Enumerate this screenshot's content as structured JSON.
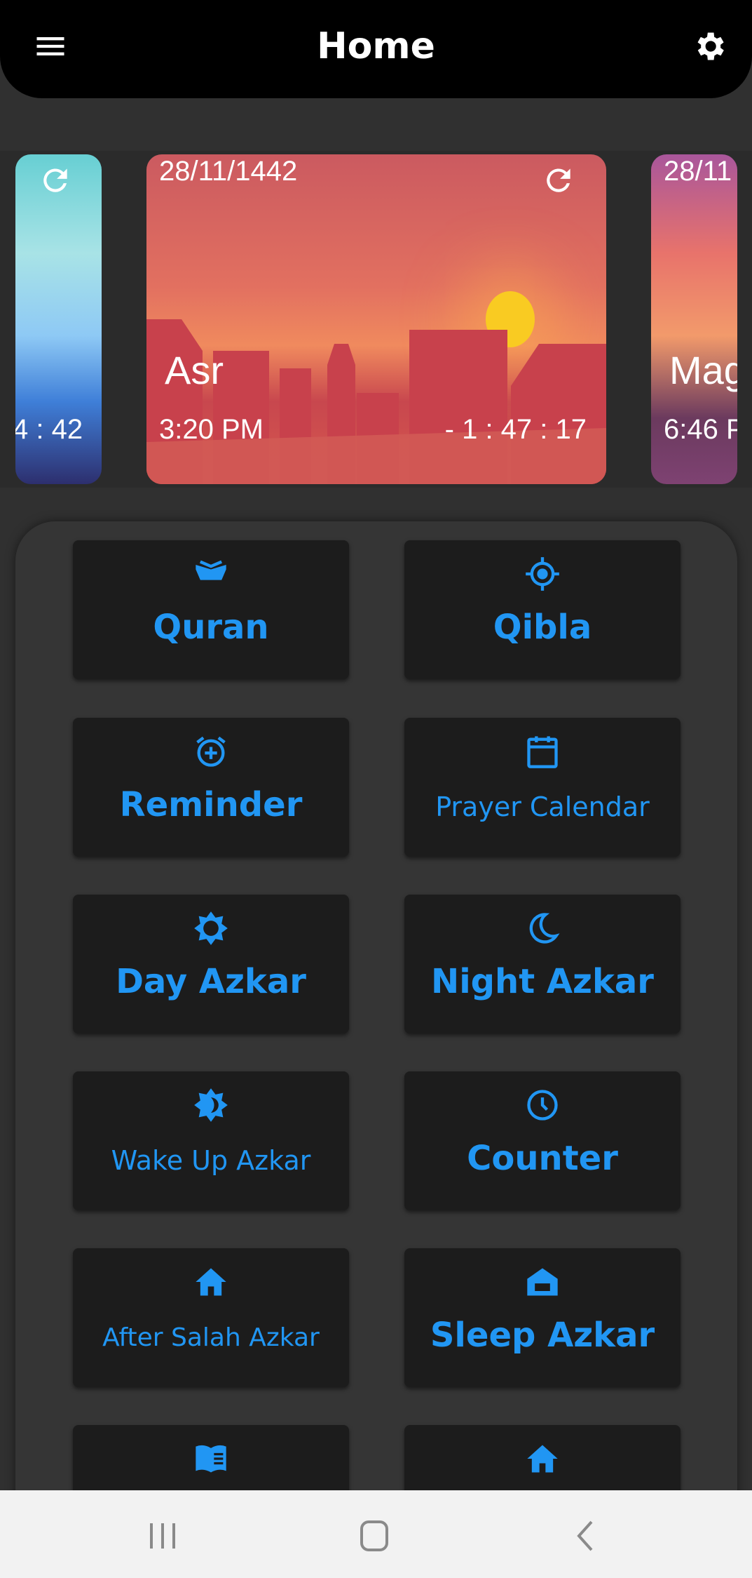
{
  "header": {
    "title": "Home",
    "menu_icon": "menu-icon",
    "settings_icon": "gear-icon"
  },
  "carousel": [
    {
      "prayer": "",
      "time": "",
      "countdown": "4 : 42",
      "date": "",
      "image": "blue city day"
    },
    {
      "prayer": "Asr",
      "time": "3:20 PM",
      "countdown": "- 1 : 47 : 17",
      "date": "28/11/1442",
      "image": "red sunset city"
    },
    {
      "prayer": "Mag",
      "time": "6:46 P",
      "countdown": "",
      "date": "28/11",
      "image": "purple sunset"
    }
  ],
  "menu": [
    {
      "label": "Quran",
      "icon": "open-book-icon",
      "size": "l"
    },
    {
      "label": "Qibla",
      "icon": "crosshair-icon",
      "size": "l"
    },
    {
      "label": "Reminder",
      "icon": "alarm-add-icon",
      "size": "l"
    },
    {
      "label": "Prayer Calendar",
      "icon": "calendar-icon",
      "size": "m"
    },
    {
      "label": "Day Azkar",
      "icon": "sun-icon",
      "size": "l"
    },
    {
      "label": "Night Azkar",
      "icon": "moon-icon",
      "size": "l"
    },
    {
      "label": "Wake Up Azkar",
      "icon": "half-sun-icon",
      "size": "m"
    },
    {
      "label": "Counter",
      "icon": "clock-icon",
      "size": "l"
    },
    {
      "label": "After Salah Azkar",
      "icon": "house-icon",
      "size": "s"
    },
    {
      "label": "Sleep Azkar",
      "icon": "bed-house-icon",
      "size": "l"
    },
    {
      "label": "",
      "icon": "reading-book-icon",
      "size": "l"
    },
    {
      "label": "",
      "icon": "house-icon",
      "size": "l"
    }
  ],
  "colors": {
    "accent": "#2196f3",
    "button_bg": "#1c1c1c",
    "panel_bg": "#353535"
  }
}
